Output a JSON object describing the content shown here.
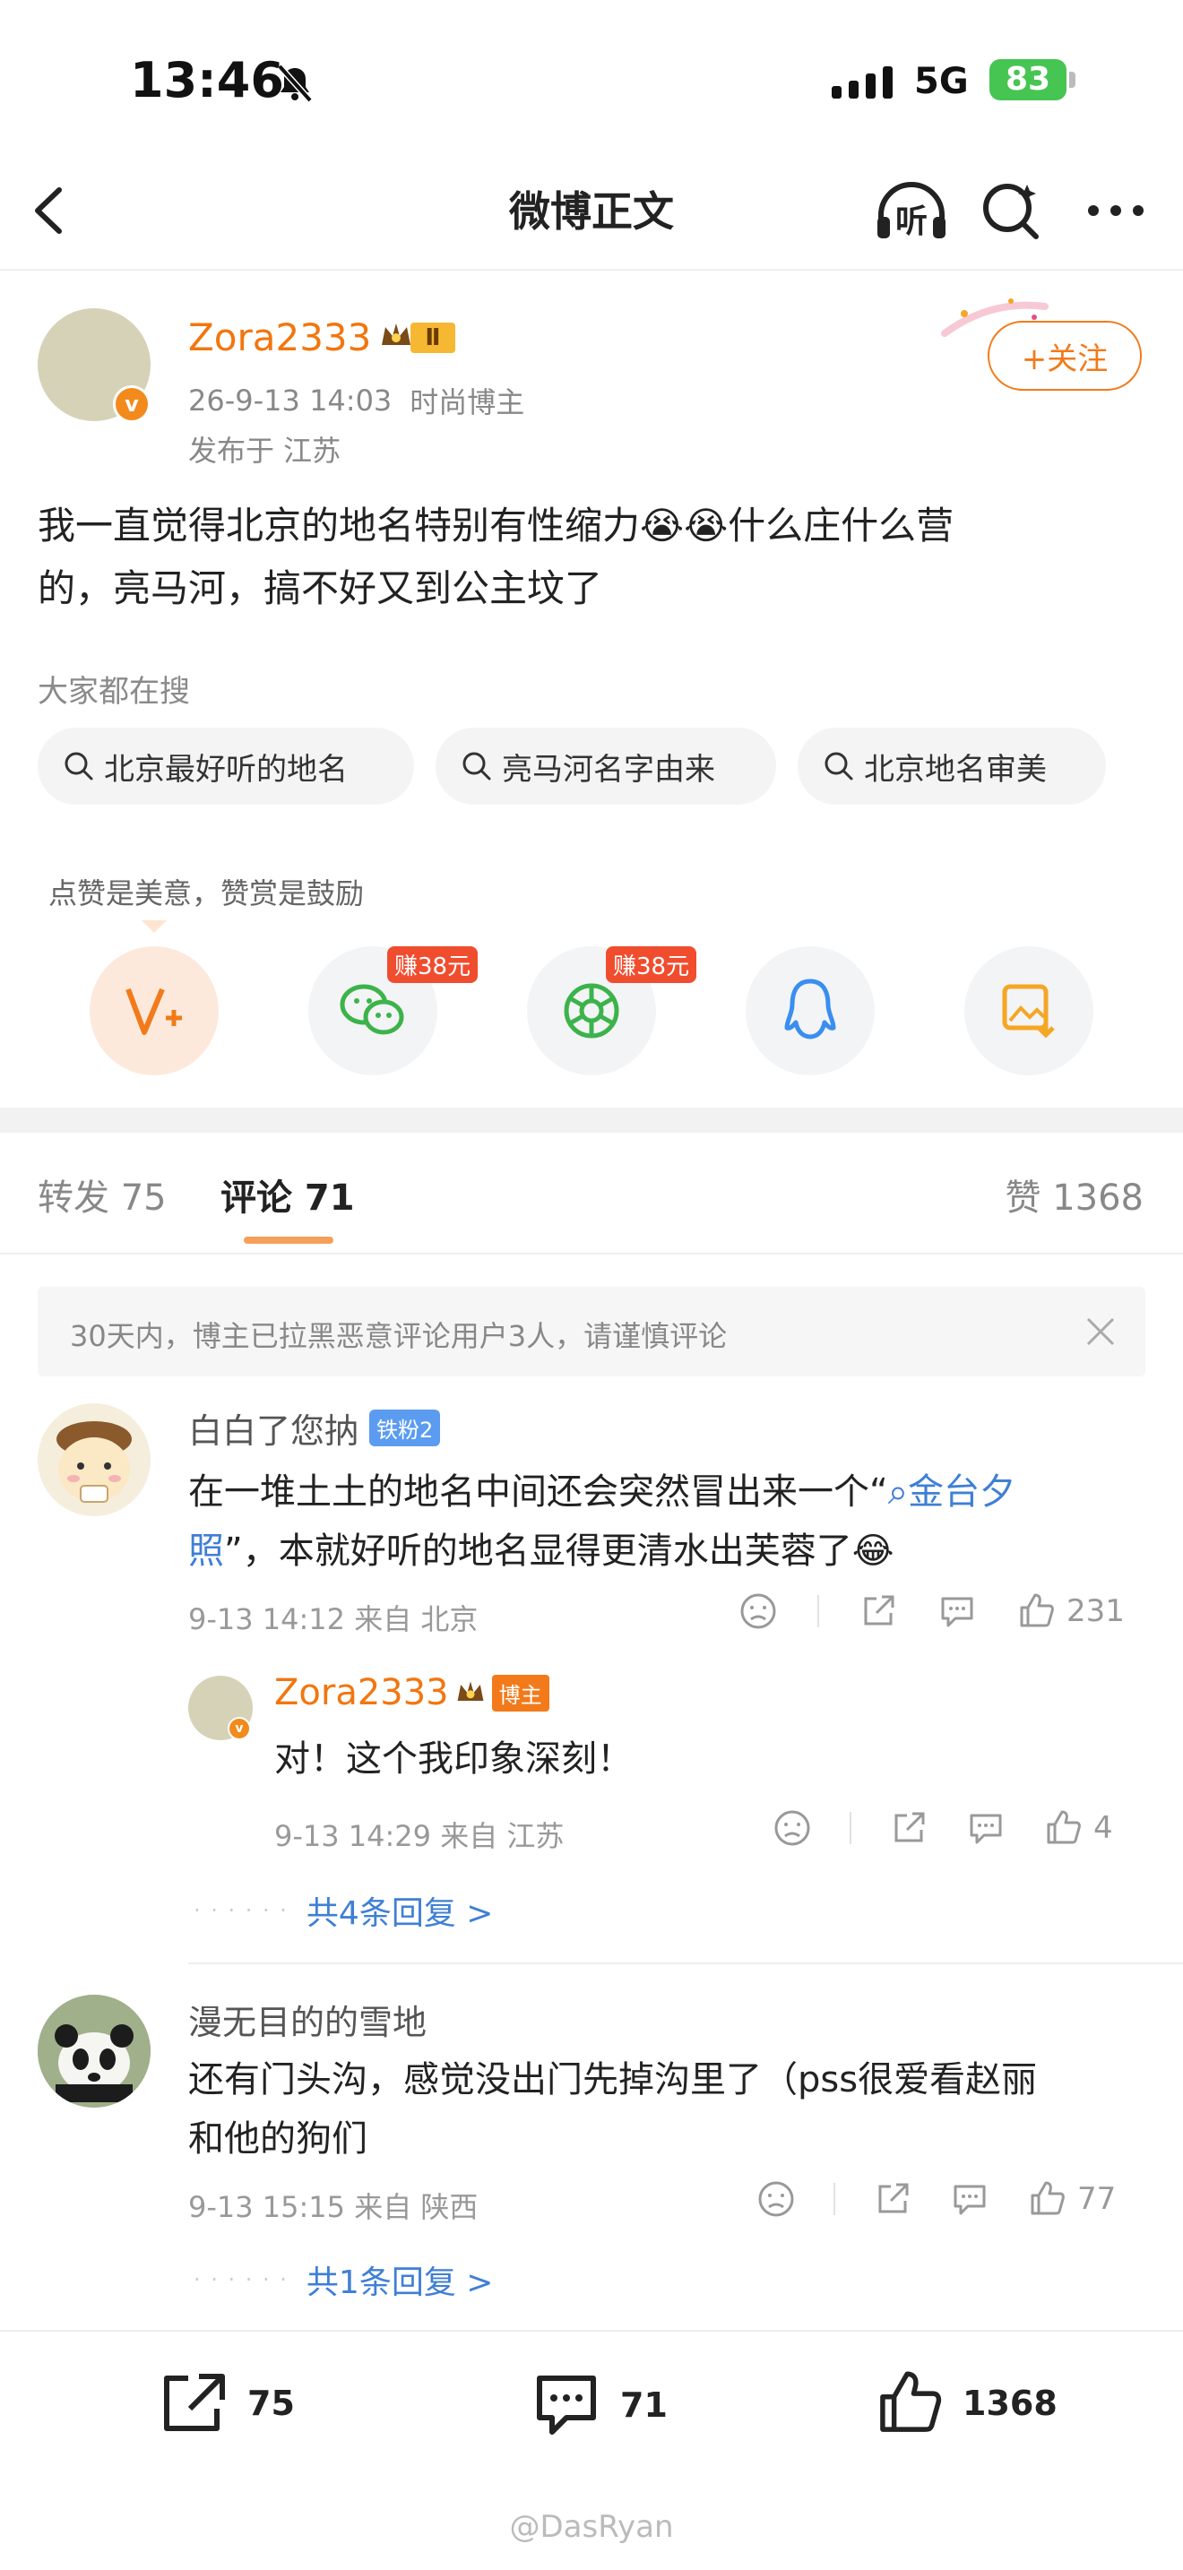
{
  "status_bar": {
    "time": "13:46",
    "network": "5G",
    "battery": "83"
  },
  "nav": {
    "title": "微博正文",
    "listen_label": "听"
  },
  "post": {
    "author": "Zora2333",
    "level_badge": "Ⅱ",
    "time": "26-9-13 14:03",
    "identity": "时尚博主",
    "location": "发布于 江苏",
    "follow_label": "+关注",
    "text_line1": "我一直觉得北京的地名特别有性缩力😭😭什么庄什么营",
    "text_line2": "的，亮马河，搞不好又到公主坟了",
    "search_title": "大家都在搜",
    "search_chips": [
      "北京最好听的地名",
      "亮马河名字由来",
      "北京地名审美"
    ],
    "reward_hint": "点赞是美意，赞赏是鼓励",
    "earn_badge": "赚38元"
  },
  "tabs": {
    "repost": "转发 75",
    "comments": "评论 71",
    "likes": "赞 1368"
  },
  "notice": "30天内，博主已拉黑恶意评论用户3人，请谨慎评论",
  "comments": [
    {
      "name": "白白了您抐",
      "badge": "铁粉2",
      "text_line1_pre": "在一堆土土的地名中间还会突然冒出来一个“",
      "text_link_1": "金台夕",
      "text_link_2": "照",
      "text_line2_post": "”，本就好听的地名显得更清水出芙蓉了😂",
      "meta": "9-13 14:12  来自 北京",
      "likes": "231",
      "reply": {
        "name": "Zora2333",
        "badge": "博主",
        "text": "对！这个我印象深刻！",
        "meta": "9-13 14:29  来自 江苏",
        "likes": "4"
      },
      "more_replies": "共4条回复 >"
    },
    {
      "name": "漫无目的的雪地",
      "text_line1": "还有门头沟，感觉没出门先掉沟里了（pss很爱看赵丽",
      "text_line2": "和他的狗们",
      "meta": "9-13 15:15  来自 陕西",
      "likes": "77",
      "more_replies": "共1条回复 >"
    }
  ],
  "bottom_bar": {
    "repost": "75",
    "comment": "71",
    "like": "1368"
  },
  "watermark": "@DasRyan",
  "colors": {
    "accent": "#f2760f",
    "link": "#3f7fd6",
    "battery": "#46c552",
    "earn": "#f04d2f"
  }
}
